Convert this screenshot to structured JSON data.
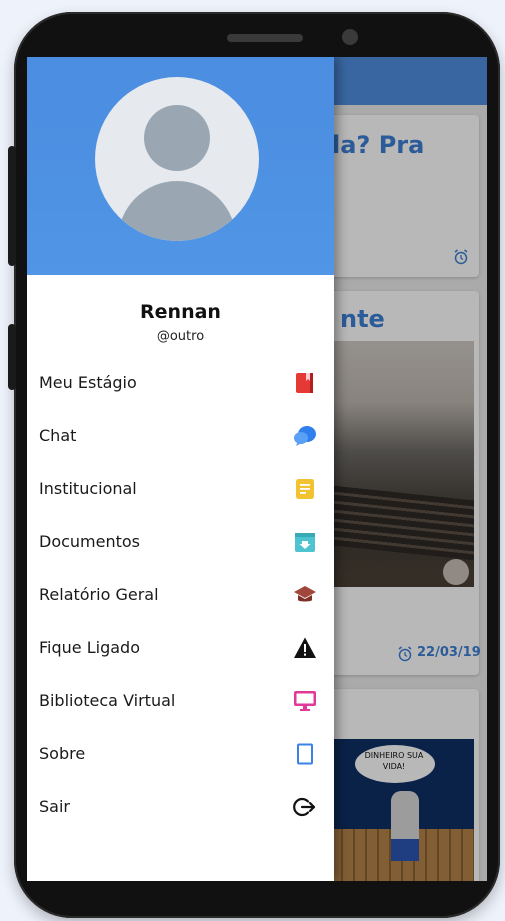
{
  "user": {
    "name": "Rennan",
    "handle": "@outro"
  },
  "menu": [
    {
      "label": "Meu Estágio",
      "icon": "book-icon",
      "color": "#e53935"
    },
    {
      "label": "Chat",
      "icon": "chat-bubbles-icon",
      "color": "#2f80ed"
    },
    {
      "label": "Institucional",
      "icon": "document-icon",
      "color": "#f2c230"
    },
    {
      "label": "Documentos",
      "icon": "download-box-icon",
      "color": "#4fc3d0"
    },
    {
      "label": "Relatório Geral",
      "icon": "graduation-cap-icon",
      "color": "#a0463a"
    },
    {
      "label": "Fique Ligado",
      "icon": "warning-icon",
      "color": "#111111"
    },
    {
      "label": "Biblioteca Virtual",
      "icon": "monitor-icon",
      "color": "#e0399a"
    },
    {
      "label": "Sobre",
      "icon": "tablet-icon",
      "color": "#3b82e6"
    },
    {
      "label": "Sair",
      "icon": "logout-icon",
      "color": "#111111"
    }
  ],
  "background": {
    "card1_title": "la? Pra",
    "card2_title": "nte",
    "card2_date": "22/03/19",
    "comic_text": "DINHEIRO SUA VIDA!"
  },
  "colors": {
    "header": "#4f8ee0",
    "accent_blue": "#3c7fd4"
  }
}
